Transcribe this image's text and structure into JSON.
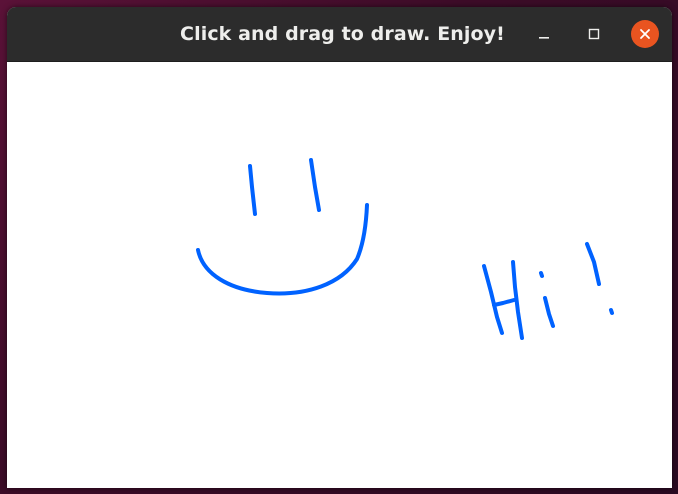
{
  "window": {
    "title": "Click and drag to draw. Enjoy!",
    "controls": {
      "minimize_icon": "minimize-icon",
      "maximize_icon": "maximize-icon",
      "close_icon": "close-icon"
    },
    "close_color": "#e95420",
    "titlebar_color": "#2c2c2c"
  },
  "canvas": {
    "background": "#ffffff",
    "stroke_color": "#0062ff"
  }
}
